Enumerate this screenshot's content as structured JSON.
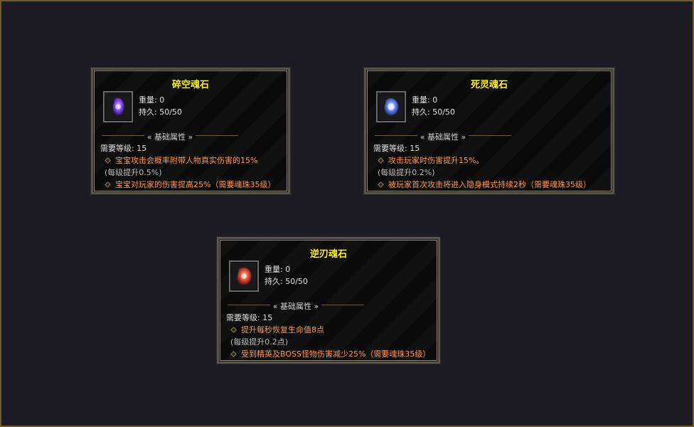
{
  "cards": [
    {
      "title": "碎空魂石",
      "weight": "重量: 0",
      "durability": "持久: 50/50",
      "section": "基础属性",
      "req": "需要等级: 15",
      "line1": "宝宝攻击会概率附带人物真实伤害的15%",
      "line2": "(每级提升0.5%)",
      "line3": "宝宝对玩家的伤害提高25%（需要魂珠35级）",
      "icon": "purple-soulstone-icon",
      "icon_color": "#9a5cff"
    },
    {
      "title": "死灵魂石",
      "weight": "重量: 0",
      "durability": "持久: 50/50",
      "section": "基础属性",
      "req": "需要等级: 15",
      "line1": "攻击玩家时伤害提升15%。",
      "line2": "(每级提升0.2%)",
      "line3": "被玩家首次攻击将进入隐身模式持续2秒（需要魂珠35级）",
      "icon": "blue-soulstone-icon",
      "icon_color": "#7fa8ff"
    },
    {
      "title": "逆刃魂石",
      "weight": "重量: 0",
      "durability": "持久: 50/50",
      "section": "基础属性",
      "req": "需要等级: 15",
      "line1": "提升每秒恢复生命值8点",
      "line2": "(每级提升0.2点)",
      "line3": "受到精英及BOSS怪物伤害减少25%（需要魂珠35级）",
      "icon": "red-soulstone-icon",
      "icon_color": "#ff6a4a"
    }
  ]
}
